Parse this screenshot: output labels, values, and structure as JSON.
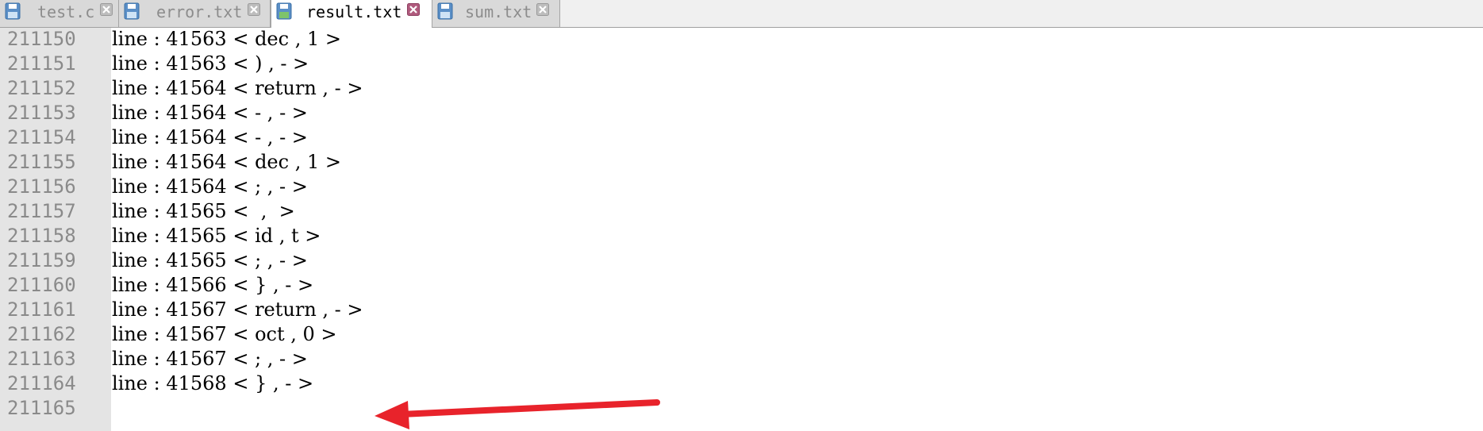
{
  "tabs": [
    {
      "label": "test.c",
      "active": false
    },
    {
      "label": "error.txt",
      "active": false
    },
    {
      "label": "result.txt",
      "active": true
    },
    {
      "label": "sum.txt",
      "active": false
    }
  ],
  "lines": [
    {
      "num": "211150",
      "text": "line : 41563 < dec , 1 >"
    },
    {
      "num": "211151",
      "text": "line : 41563 < ) , - >"
    },
    {
      "num": "211152",
      "text": "line : 41564 < return , - >"
    },
    {
      "num": "211153",
      "text": "line : 41564 < - , - >"
    },
    {
      "num": "211154",
      "text": "line : 41564 < - , - >"
    },
    {
      "num": "211155",
      "text": "line : 41564 < dec , 1 >"
    },
    {
      "num": "211156",
      "text": "line : 41564 < ; , - >"
    },
    {
      "num": "211157",
      "text": "line : 41565 <  ,  >"
    },
    {
      "num": "211158",
      "text": "line : 41565 < id , t >"
    },
    {
      "num": "211159",
      "text": "line : 41565 < ; , - >"
    },
    {
      "num": "211160",
      "text": "line : 41566 < } , - >"
    },
    {
      "num": "211161",
      "text": "line : 41567 < return , - >"
    },
    {
      "num": "211162",
      "text": "line : 41567 < oct , 0 >"
    },
    {
      "num": "211163",
      "text": "line : 41567 < ; , - >"
    },
    {
      "num": "211164",
      "text": "line : 41568 < } , - >"
    },
    {
      "num": "211165",
      "text": ""
    }
  ],
  "colors": {
    "accent_arrow": "#e8232b",
    "gutter_bg": "#e4e4e4",
    "line_number": "#8a8a8a"
  },
  "icons": {
    "tab_icon": "floppy-disk-save-icon",
    "tab_close": "close-x-icon",
    "annotation": "red-arrow-icon"
  }
}
